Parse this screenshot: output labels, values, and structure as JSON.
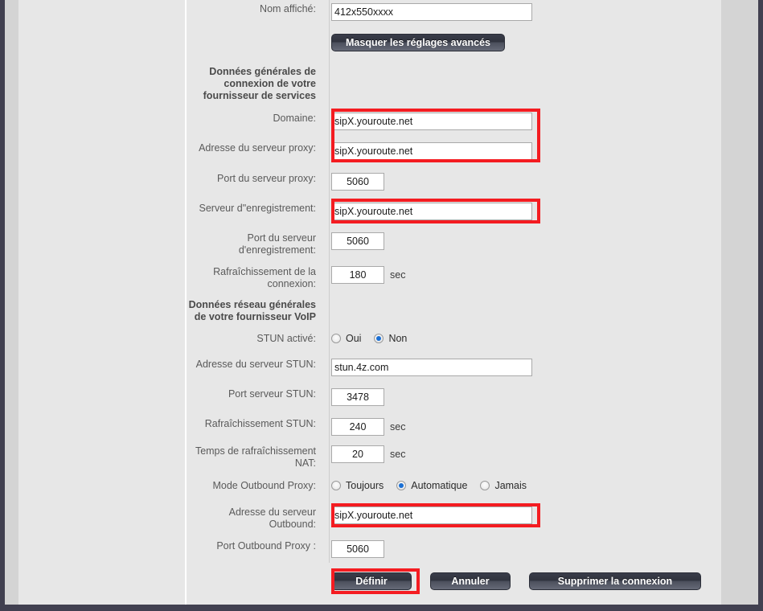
{
  "form": {
    "display_name": {
      "label": "Nom affiché:",
      "value": "412x550xxxx"
    },
    "advanced_button": "Masquer les réglages avancés",
    "section_provider": "Données générales de\nconnexion de votre\nfournisseur de services",
    "domain": {
      "label": "Domaine:",
      "value": "sipX.youroute.net"
    },
    "proxy_address": {
      "label": "Adresse du serveur proxy:",
      "value": "sipX.youroute.net"
    },
    "proxy_port": {
      "label": "Port du serveur proxy:",
      "value": "5060"
    },
    "registration_server": {
      "label": "Serveur d\"enregistrement:",
      "value": "sipX.youroute.net"
    },
    "registration_port": {
      "label": "Port du serveur\nd'enregistrement:",
      "value": "5060"
    },
    "connection_refresh": {
      "label": "Rafraîchissement de la\nconnexion:",
      "value": "180",
      "unit": "sec"
    },
    "section_network": "Données réseau générales\nde votre fournisseur VoIP",
    "stun_enabled": {
      "label": "STUN activé:",
      "options": [
        "Oui",
        "Non"
      ],
      "selected": "Non"
    },
    "stun_address": {
      "label": "Adresse du serveur STUN:",
      "value": "stun.4z.com"
    },
    "stun_port": {
      "label": "Port serveur STUN:",
      "value": "3478"
    },
    "stun_refresh": {
      "label": "Rafraîchissement STUN:",
      "value": "240",
      "unit": "sec"
    },
    "nat_refresh": {
      "label": "Temps de rafraîchissement\nNAT:",
      "value": "20",
      "unit": "sec"
    },
    "outbound_mode": {
      "label": "Mode Outbound Proxy:",
      "options": [
        "Toujours",
        "Automatique",
        "Jamais"
      ],
      "selected": "Automatique"
    },
    "outbound_address": {
      "label": "Adresse du serveur\nOutbound:",
      "value": "sipX.youroute.net"
    },
    "outbound_port": {
      "label": "Port Outbound Proxy :",
      "value": "5060"
    },
    "buttons": {
      "define": "Définir",
      "cancel": "Annuler",
      "delete": "Supprimer la connexion"
    }
  },
  "highlight_color": "#f41c21"
}
